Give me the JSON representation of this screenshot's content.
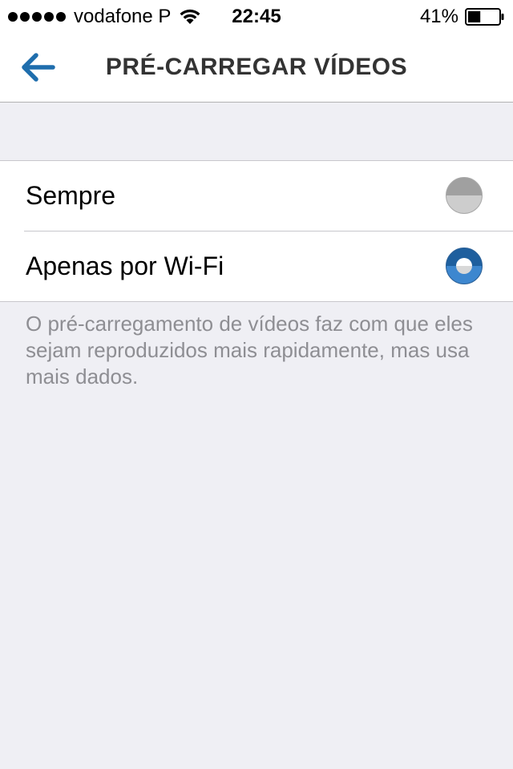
{
  "status_bar": {
    "signal_bars": 5,
    "carrier": "vodafone P",
    "wifi_icon": "wifi-icon",
    "time": "22:45",
    "battery_percent": "41%",
    "battery_level": 0.41
  },
  "nav": {
    "back_icon": "back-arrow-icon",
    "title": "PRÉ-CARREGAR VÍDEOS"
  },
  "options": [
    {
      "label": "Sempre",
      "selected": false
    },
    {
      "label": "Apenas por Wi-Fi",
      "selected": true
    }
  ],
  "description": "O pré-carregamento de vídeos faz com que eles sejam reproduzidos mais rapidamente, mas usa mais dados.",
  "colors": {
    "accent": "#1e5f9e",
    "background": "#efeff4",
    "secondary_text": "#8e8e93",
    "title_text": "#333333"
  }
}
